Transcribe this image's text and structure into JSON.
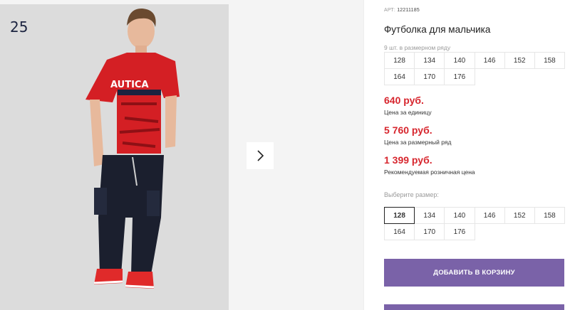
{
  "gallery": {
    "counter": "25",
    "colors": {
      "shirt": "#d41f24",
      "trousers": "#1b1f2e",
      "shoes": "#e02a2a",
      "background": "#dcdcdc"
    },
    "next_icon": "chevron-right-icon",
    "shirt_print_text": "AUTICA"
  },
  "product": {
    "art_label": "АРТ:",
    "art_value": "12211185",
    "title": "Футболка для мальчика",
    "pack_note": "9 шт. в размерном ряду",
    "pack_sizes": [
      "128",
      "134",
      "140",
      "146",
      "152",
      "158",
      "164",
      "170",
      "176"
    ],
    "prices": [
      {
        "value": "640 руб.",
        "note": "Цена за единицу"
      },
      {
        "value": "5 760 руб.",
        "note": "Цена за размерный ряд"
      },
      {
        "value": "1 399 руб.",
        "note": "Рекомендуемая розничная цена"
      }
    ],
    "choose_label": "Выберите размер:",
    "select_sizes": [
      "128",
      "134",
      "140",
      "146",
      "152",
      "158",
      "164",
      "170",
      "176"
    ],
    "selected_size": "128",
    "add_to_cart": "ДОБАВИТЬ В КОРЗИНУ",
    "accent_color": "#7a62a8",
    "price_color": "#d7262e"
  }
}
